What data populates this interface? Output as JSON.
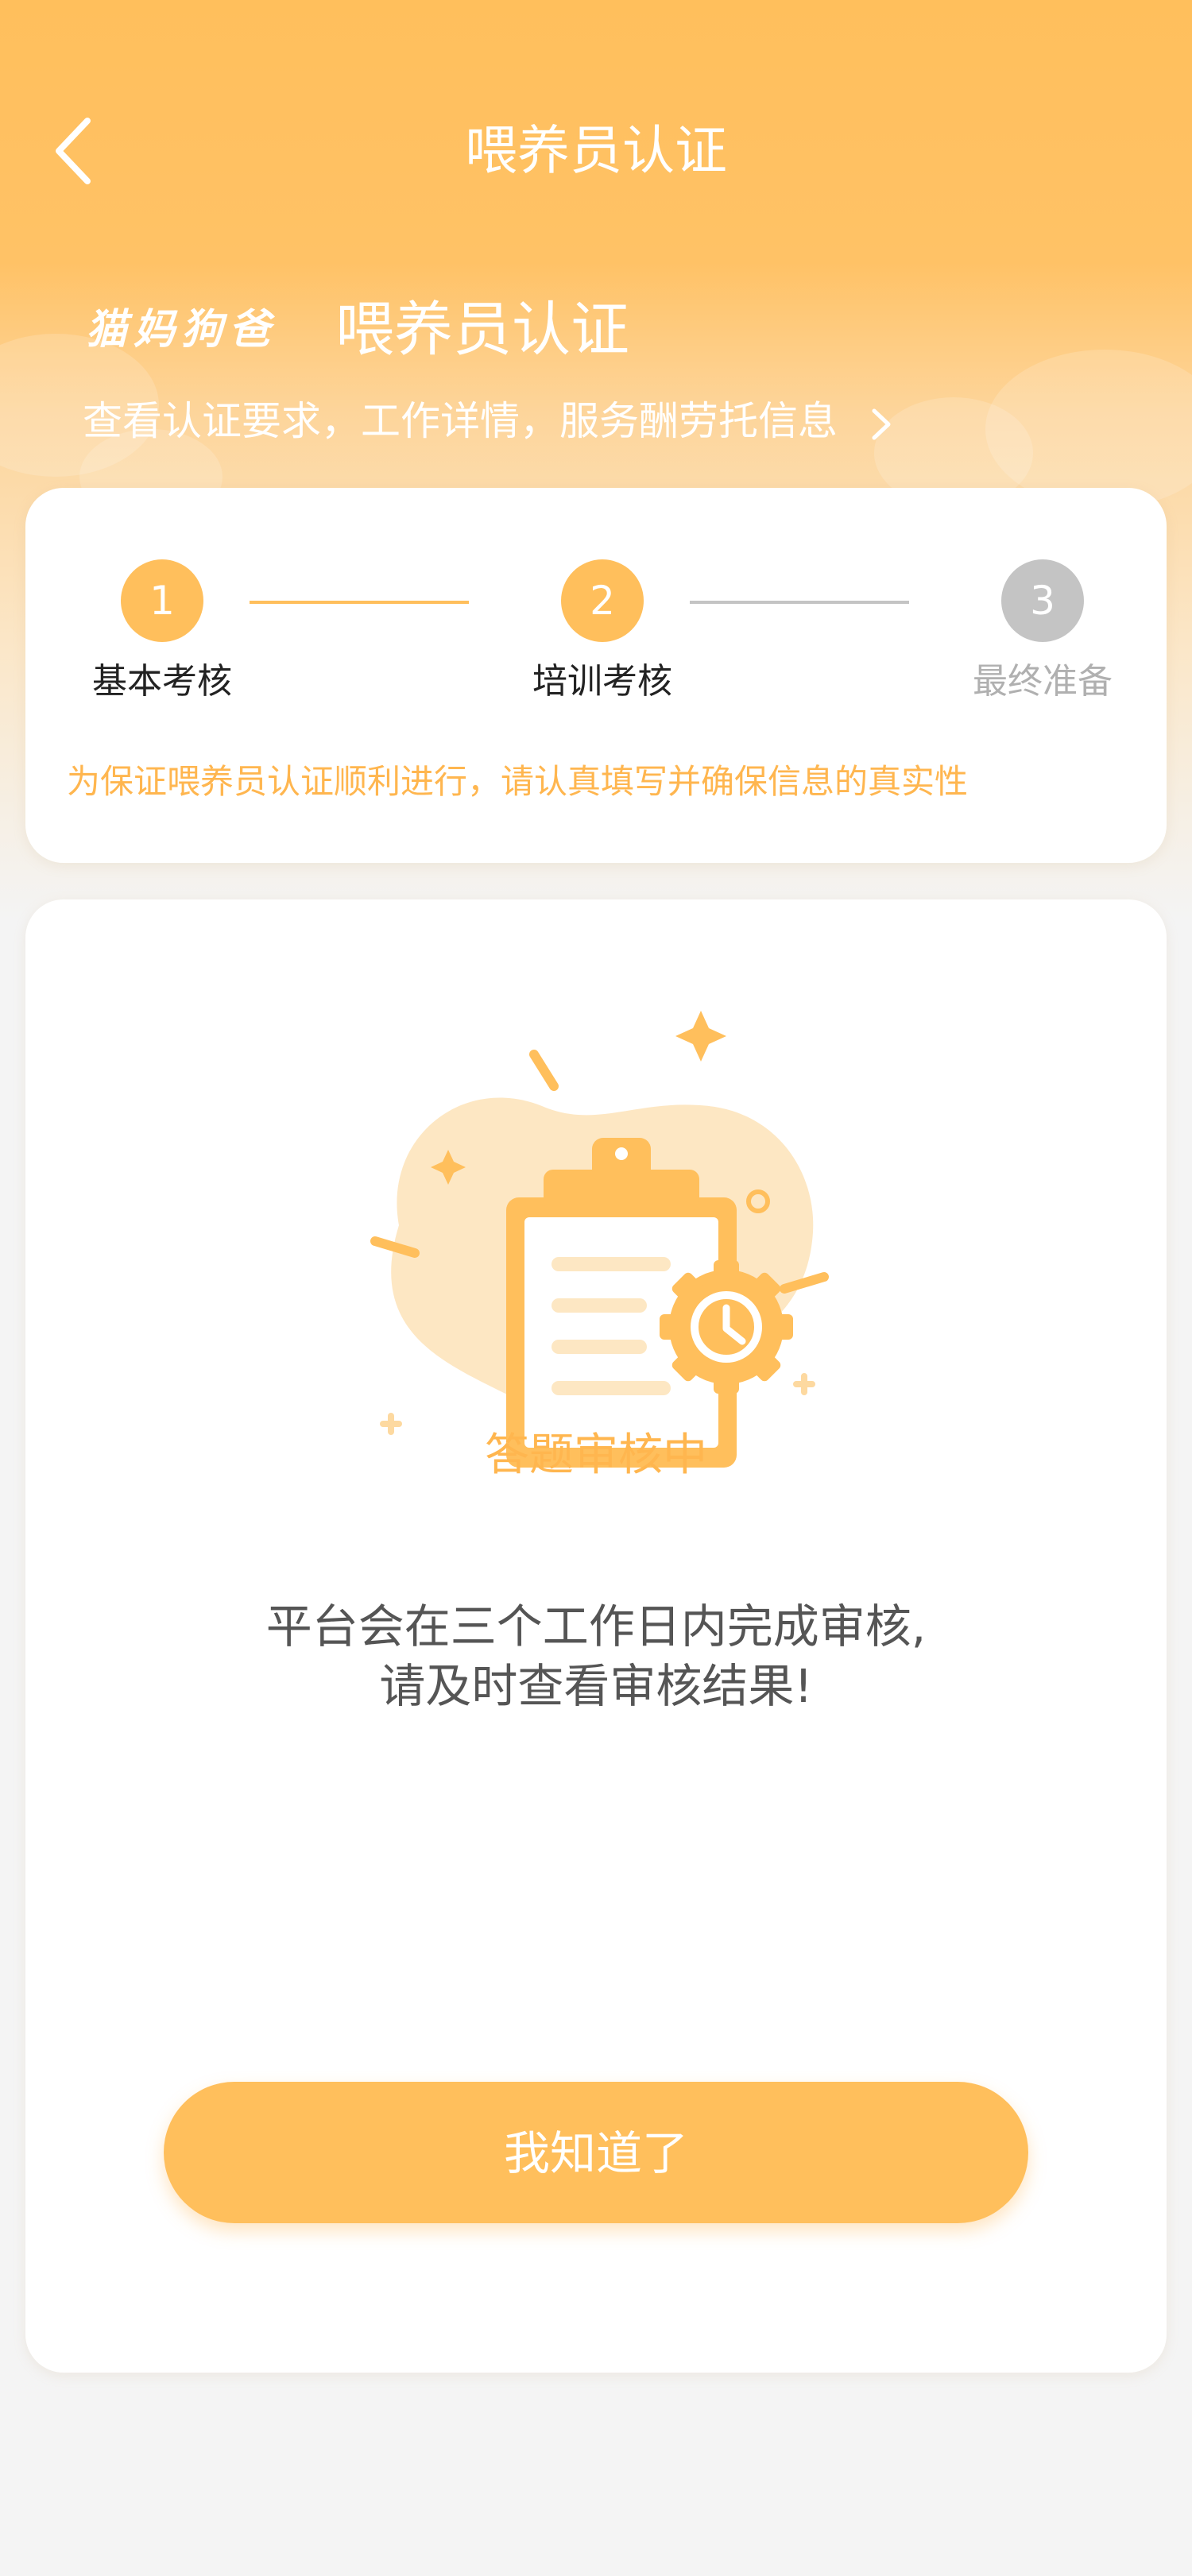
{
  "header": {
    "title": "喂养员认证"
  },
  "brand": {
    "logo_text": "猫妈狗爸",
    "title": "喂养员认证",
    "subtitle": "查看认证要求，工作详情，服务酬劳托信息"
  },
  "steps": [
    {
      "number": "1",
      "label": "基本考核",
      "state": "done"
    },
    {
      "number": "2",
      "label": "培训考核",
      "state": "current"
    },
    {
      "number": "3",
      "label": "最终准备",
      "state": "pending"
    }
  ],
  "notice": "为保证喂养员认证顺利进行，请认真填写并确保信息的真实性",
  "status": {
    "title": "答题审核中",
    "message_line1": "平台会在三个工作日内完成审核,",
    "message_line2": "请及时查看审核结果!"
  },
  "confirm_button": "我知道了",
  "colors": {
    "accent": "#ffbf5c",
    "accent_text": "#ffb64f",
    "inactive": "#c4c4c4",
    "text_dark": "#222222",
    "text_gray": "#555555"
  },
  "icons": {
    "back": "chevron-left-icon",
    "subtitle_arrow": "chevron-right-icon",
    "illustration": "clipboard-clock-icon"
  }
}
